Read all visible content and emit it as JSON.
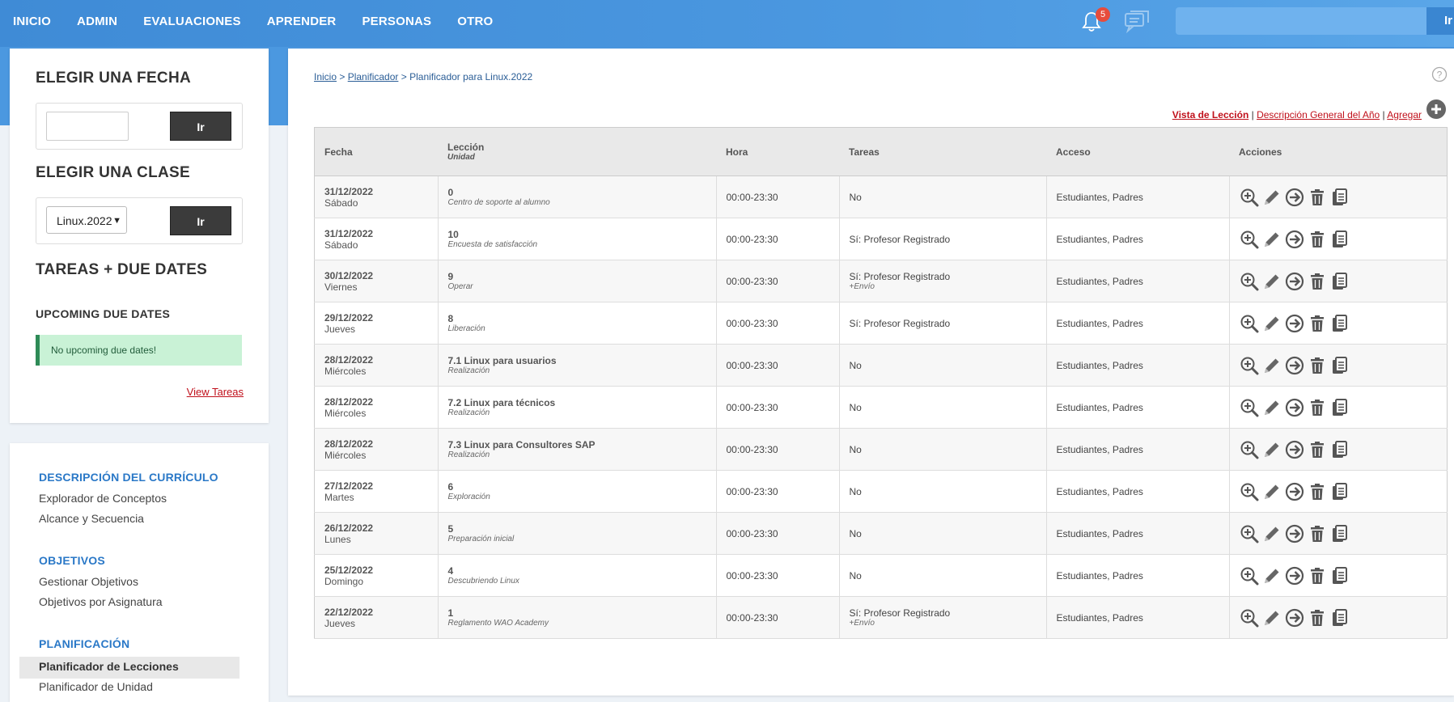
{
  "nav": [
    "INICIO",
    "ADMIN",
    "EVALUACIONES",
    "APRENDER",
    "PERSONAS",
    "OTRO"
  ],
  "notifications": {
    "count": "5"
  },
  "search": {
    "button": "Ir"
  },
  "sidebar": {
    "date_title": "ELEGIR UNA FECHA",
    "date_button": "Ir",
    "class_title": "ELEGIR UNA CLASE",
    "class_value": "Linux.2022",
    "class_button": "Ir",
    "tareas_title": "TAREAS + DUE DATES",
    "upcoming_title": "UPCOMING DUE DATES",
    "no_due": "No upcoming due dates!",
    "view_tareas": "View Tareas"
  },
  "menu": {
    "curriculo": "DESCRIPCIÓN DEL CURRÍCULO",
    "explorador": "Explorador de Conceptos",
    "alcance": "Alcance y Secuencia",
    "objetivos": "OBJETIVOS",
    "gestionar": "Gestionar Objetivos",
    "por_asignatura": "Objetivos por Asignatura",
    "planificacion": "PLANIFICACIÓN",
    "planificador_lecciones": "Planificador de Lecciones",
    "planificador_unidad": "Planificador de Unidad"
  },
  "breadcrumb": {
    "inicio": "Inicio",
    "sep1": " > ",
    "planificador": "Planificador",
    "sep2": " > ",
    "current": "Planificador para Linux.2022"
  },
  "views": {
    "leccion": "Vista de Lección",
    "sep1": " | ",
    "anio": "Descripción General del Año",
    "sep2": " | ",
    "agregar": "Agregar"
  },
  "table": {
    "headers": {
      "fecha": "Fecha",
      "leccion": "Lección",
      "unidad": "Unidad",
      "hora": "Hora",
      "tareas": "Tareas",
      "acceso": "Acceso",
      "acciones": "Acciones"
    },
    "rows": [
      {
        "date": "31/12/2022",
        "day": "Sábado",
        "lesson": "0",
        "unit": "Centro de soporte al alumno",
        "hora": "00:00-23:30",
        "tareas": "No",
        "tareas2": "",
        "acceso": "Estudiantes, Padres"
      },
      {
        "date": "31/12/2022",
        "day": "Sábado",
        "lesson": "10",
        "unit": "Encuesta de satisfacción",
        "hora": "00:00-23:30",
        "tareas": "Sí: Profesor Registrado",
        "tareas2": "",
        "acceso": "Estudiantes, Padres"
      },
      {
        "date": "30/12/2022",
        "day": "Viernes",
        "lesson": "9",
        "unit": "Operar",
        "hora": "00:00-23:30",
        "tareas": "Sí: Profesor Registrado",
        "tareas2": "+Envío",
        "acceso": "Estudiantes, Padres"
      },
      {
        "date": "29/12/2022",
        "day": "Jueves",
        "lesson": "8",
        "unit": "Liberación",
        "hora": "00:00-23:30",
        "tareas": "Sí: Profesor Registrado",
        "tareas2": "",
        "acceso": "Estudiantes, Padres"
      },
      {
        "date": "28/12/2022",
        "day": "Miércoles",
        "lesson": "7.1 Linux para usuarios",
        "unit": "Realización",
        "hora": "00:00-23:30",
        "tareas": "No",
        "tareas2": "",
        "acceso": "Estudiantes, Padres"
      },
      {
        "date": "28/12/2022",
        "day": "Miércoles",
        "lesson": "7.2 Linux para técnicos",
        "unit": "Realización",
        "hora": "00:00-23:30",
        "tareas": "No",
        "tareas2": "",
        "acceso": "Estudiantes, Padres"
      },
      {
        "date": "28/12/2022",
        "day": "Miércoles",
        "lesson": "7.3 Linux para Consultores SAP",
        "unit": "Realización",
        "hora": "00:00-23:30",
        "tareas": "No",
        "tareas2": "",
        "acceso": "Estudiantes, Padres"
      },
      {
        "date": "27/12/2022",
        "day": "Martes",
        "lesson": "6",
        "unit": "Exploración",
        "hora": "00:00-23:30",
        "tareas": "No",
        "tareas2": "",
        "acceso": "Estudiantes, Padres"
      },
      {
        "date": "26/12/2022",
        "day": "Lunes",
        "lesson": "5",
        "unit": "Preparación inicial",
        "hora": "00:00-23:30",
        "tareas": "No",
        "tareas2": "",
        "acceso": "Estudiantes, Padres"
      },
      {
        "date": "25/12/2022",
        "day": "Domingo",
        "lesson": "4",
        "unit": "Descubriendo Linux",
        "hora": "00:00-23:30",
        "tareas": "No",
        "tareas2": "",
        "acceso": "Estudiantes, Padres"
      },
      {
        "date": "22/12/2022",
        "day": "Jueves",
        "lesson": "1",
        "unit": "Reglamento WAO Academy",
        "hora": "00:00-23:30",
        "tareas": "Sí: Profesor Registrado",
        "tareas2": "+Envío",
        "acceso": "Estudiantes, Padres"
      }
    ]
  },
  "icons": {
    "bell": "bell-icon",
    "chat": "chat-icon",
    "help": "help-icon",
    "add": "add-circle-icon",
    "row_actions": [
      "zoom-in-icon",
      "pencil-icon",
      "arrow-right-circle-icon",
      "trash-icon",
      "copy-icon"
    ]
  },
  "colors": {
    "topbar": "#4b98e0",
    "link_red": "#c0101b",
    "section_blue": "#2a78c7",
    "success_bg": "#c9f2d6"
  }
}
